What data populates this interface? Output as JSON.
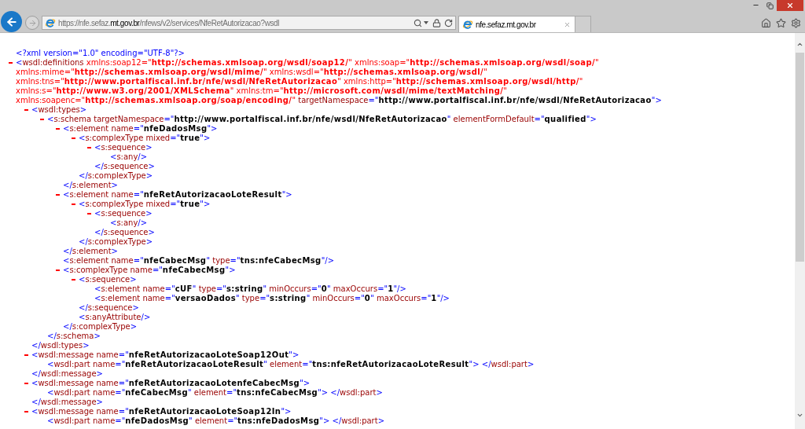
{
  "browser": {
    "navigation": [
      {
        "kind": "back",
        "disabled": false
      },
      {
        "kind": "forward",
        "disabled": true
      }
    ],
    "address_bar": {
      "url": {
        "prefix": "https://nfe.sefaz.",
        "domain": "mt.gov.br",
        "path": "/nfews/v2/services/NfeRetAutorizacao?wsdl"
      }
    },
    "tabs": [
      {
        "title": "nfe.sefaz.mt.gov.br",
        "selected": true
      }
    ]
  },
  "document": [
    {
      "kind": "declaration",
      "text": "<?xml version=\"1.0\" encoding=\"UTF-8\"?>"
    },
    {
      "kind": "element",
      "expanded": true,
      "open": "<wsdl:definitions",
      "attributes": [
        {
          "kind": "namespace",
          "text": "xmlns:soap12=\"http://schemas.xmlsoap.org/wsdl/soap12/\""
        },
        {
          "kind": "namespace",
          "text": "xmlns:soap=\"http://schemas.xmlsoap.org/wsdl/soap/\""
        },
        {
          "kind": "namespace",
          "text": "xmlns:mime=\"http://schemas.xmlsoap.org/wsdl/mime/\""
        },
        {
          "kind": "namespace",
          "text": "xmlns:wsdl=\"http://schemas.xmlsoap.org/wsdl/\""
        },
        {
          "kind": "namespace",
          "text": "xmlns:tns=\"http://www.portalfiscal.inf.br/nfe/wsdl/NfeRetAutorizacao\""
        },
        {
          "kind": "namespace",
          "text": "xmlns:http=\"http://schemas.xmlsoap.org/wsdl/http/\""
        },
        {
          "kind": "namespace",
          "text": "xmlns:s=\"http://www.w3.org/2001/XMLSchema\""
        },
        {
          "kind": "namespace",
          "text": "xmlns:tm=\"http://microsoft.com/wsdl/mime/textMatching/\""
        },
        {
          "kind": "namespace",
          "text": "xmlns:soapenc=\"http://schemas.xmlsoap.org/soap/encoding/\""
        },
        {
          "kind": "plain",
          "text": "targetNamespace=\"http://www.portalfiscal.inf.br/nfe/wsdl/NfeRetAutorizacao\""
        }
      ],
      "end": ">",
      "children": [
        {
          "kind": "element",
          "expanded": true,
          "open": "<wsdl:types",
          "end": ">",
          "children": [
            {
              "kind": "element",
              "expanded": true,
              "open": "<s:schema",
              "attributes": [
                {
                  "kind": "plain",
                  "text": "targetNamespace=\"http://www.portalfiscal.inf.br/nfe/wsdl/NfeRetAutorizacao\""
                },
                {
                  "kind": "plain",
                  "text": "elementFormDefault=\"qualified\""
                }
              ],
              "end": ">",
              "children": [
                {
                  "kind": "element",
                  "expanded": true,
                  "open": "<s:element",
                  "attributes": [
                    {
                      "kind": "plain",
                      "text": "name=\"nfeDadosMsg\""
                    }
                  ],
                  "end": ">",
                  "children": [
                    {
                      "kind": "element",
                      "expanded": true,
                      "open": "<s:complexType",
                      "attributes": [
                        {
                          "kind": "plain",
                          "text": "mixed=\"true\""
                        }
                      ],
                      "end": ">",
                      "children": [
                        {
                          "kind": "element",
                          "expanded": true,
                          "open": "<s:sequence",
                          "end": ">",
                          "children": [
                            {
                              "kind": "leaf",
                              "open": "<s:any",
                              "end": "/>"
                            }
                          ],
                          "close": "</s:sequence>"
                        }
                      ],
                      "close": "</s:complexType>"
                    }
                  ],
                  "close": "</s:element>"
                },
                {
                  "kind": "element",
                  "expanded": true,
                  "open": "<s:element",
                  "attributes": [
                    {
                      "kind": "plain",
                      "text": "name=\"nfeRetAutorizacaoLoteResult\""
                    }
                  ],
                  "end": ">",
                  "children": [
                    {
                      "kind": "element",
                      "expanded": true,
                      "open": "<s:complexType",
                      "attributes": [
                        {
                          "kind": "plain",
                          "text": "mixed=\"true\""
                        }
                      ],
                      "end": ">",
                      "children": [
                        {
                          "kind": "element",
                          "expanded": true,
                          "open": "<s:sequence",
                          "end": ">",
                          "children": [
                            {
                              "kind": "leaf",
                              "open": "<s:any",
                              "end": "/>"
                            }
                          ],
                          "close": "</s:sequence>"
                        }
                      ],
                      "close": "</s:complexType>"
                    }
                  ],
                  "close": "</s:element>"
                },
                {
                  "kind": "leaf",
                  "open": "<s:element",
                  "attributes": [
                    {
                      "kind": "plain",
                      "text": "name=\"nfeCabecMsg\""
                    },
                    {
                      "kind": "plain",
                      "text": "type=\"tns:nfeCabecMsg\""
                    }
                  ],
                  "end": "/>"
                },
                {
                  "kind": "element",
                  "expanded": true,
                  "open": "<s:complexType",
                  "attributes": [
                    {
                      "kind": "plain",
                      "text": "name=\"nfeCabecMsg\""
                    }
                  ],
                  "end": ">",
                  "children": [
                    {
                      "kind": "element",
                      "expanded": true,
                      "open": "<s:sequence",
                      "end": ">",
                      "children": [
                        {
                          "kind": "leaf",
                          "open": "<s:element",
                          "attributes": [
                            {
                              "kind": "plain",
                              "text": "name=\"cUF\""
                            },
                            {
                              "kind": "plain",
                              "text": "type=\"s:string\""
                            },
                            {
                              "kind": "plain",
                              "text": "minOccurs=\"0\""
                            },
                            {
                              "kind": "plain",
                              "text": "maxOccurs=\"1\""
                            }
                          ],
                          "end": "/>"
                        },
                        {
                          "kind": "leaf",
                          "open": "<s:element",
                          "attributes": [
                            {
                              "kind": "plain",
                              "text": "name=\"versaoDados\""
                            },
                            {
                              "kind": "plain",
                              "text": "type=\"s:string\""
                            },
                            {
                              "kind": "plain",
                              "text": "minOccurs=\"0\""
                            },
                            {
                              "kind": "plain",
                              "text": "maxOccurs=\"1\""
                            }
                          ],
                          "end": "/>"
                        }
                      ],
                      "close": "</s:sequence>"
                    },
                    {
                      "kind": "leaf",
                      "open": "<s:anyAttribute",
                      "end": "/>"
                    }
                  ],
                  "close": "</s:complexType>"
                }
              ],
              "close": "</s:schema>"
            }
          ],
          "close": "</wsdl:types>"
        },
        {
          "kind": "element",
          "expanded": true,
          "open": "<wsdl:message",
          "attributes": [
            {
              "kind": "plain",
              "text": "name=\"nfeRetAutorizacaoLoteSoap12Out\""
            }
          ],
          "end": ">",
          "children": [
            {
              "kind": "leaf",
              "open": "<wsdl:part",
              "attributes": [
                {
                  "kind": "plain",
                  "text": "name=\"nfeRetAutorizacaoLoteResult\""
                },
                {
                  "kind": "plain",
                  "text": "element=\"tns:nfeRetAutorizacaoLoteResult\""
                }
              ],
              "end": ">",
              "close": "</wsdl:part>"
            }
          ],
          "close": "</wsdl:message>"
        },
        {
          "kind": "element",
          "expanded": true,
          "open": "<wsdl:message",
          "attributes": [
            {
              "kind": "plain",
              "text": "name=\"nfeRetAutorizacaoLotenfeCabecMsg\""
            }
          ],
          "end": ">",
          "children": [
            {
              "kind": "leaf",
              "open": "<wsdl:part",
              "attributes": [
                {
                  "kind": "plain",
                  "text": "name=\"nfeCabecMsg\""
                },
                {
                  "kind": "plain",
                  "text": "element=\"tns:nfeCabecMsg\""
                }
              ],
              "end": ">",
              "close": "</wsdl:part>"
            }
          ],
          "close": "</wsdl:message>"
        },
        {
          "kind": "element",
          "expanded": true,
          "open": "<wsdl:message",
          "attributes": [
            {
              "kind": "plain",
              "text": "name=\"nfeRetAutorizacaoLoteSoap12In\""
            }
          ],
          "end": ">",
          "children": [
            {
              "kind": "leaf",
              "open": "<wsdl:part",
              "attributes": [
                {
                  "kind": "plain",
                  "text": "name=\"nfeDadosMsg\""
                },
                {
                  "kind": "plain",
                  "text": "element=\"tns:nfeDadosMsg\""
                }
              ],
              "end": ">",
              "close": "</wsdl:part>"
            }
          ]
        }
      ]
    }
  ]
}
